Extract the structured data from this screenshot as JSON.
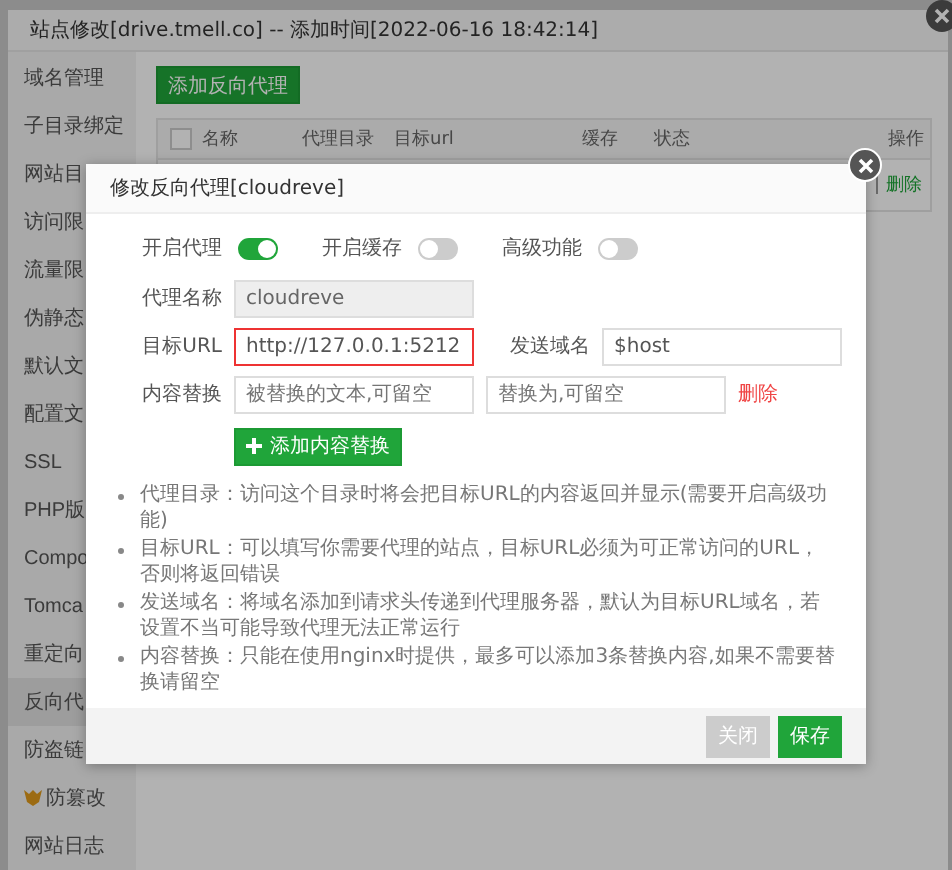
{
  "window": {
    "title": "站点修改[drive.tmell.co] -- 添加时间[2022-06-16 18:42:14]"
  },
  "sidebar": {
    "items": [
      {
        "label": "域名管理",
        "selected": false,
        "premium": false
      },
      {
        "label": "子目录绑定",
        "selected": false,
        "premium": false
      },
      {
        "label": "网站目",
        "selected": false,
        "premium": false
      },
      {
        "label": "访问限",
        "selected": false,
        "premium": false
      },
      {
        "label": "流量限",
        "selected": false,
        "premium": false
      },
      {
        "label": "伪静态",
        "selected": false,
        "premium": false
      },
      {
        "label": "默认文",
        "selected": false,
        "premium": false
      },
      {
        "label": "配置文",
        "selected": false,
        "premium": false
      },
      {
        "label": "SSL",
        "selected": false,
        "premium": false
      },
      {
        "label": "PHP版",
        "selected": false,
        "premium": false
      },
      {
        "label": "Compo",
        "selected": false,
        "premium": false
      },
      {
        "label": "Tomca",
        "selected": false,
        "premium": false
      },
      {
        "label": "重定向",
        "selected": false,
        "premium": false
      },
      {
        "label": "反向代",
        "selected": true,
        "premium": false
      },
      {
        "label": "防盗链",
        "selected": false,
        "premium": false
      },
      {
        "label": "防篡改",
        "selected": false,
        "premium": true
      },
      {
        "label": "网站日志",
        "selected": false,
        "premium": false
      }
    ]
  },
  "main": {
    "add_button": "添加反向代理",
    "table": {
      "select_all_checked": false,
      "columns": [
        "名称",
        "代理目录",
        "目标url",
        "缓存",
        "状态",
        "操作"
      ],
      "rows": [
        {
          "actions": "删除"
        }
      ]
    }
  },
  "dialog": {
    "title": "修改反向代理[cloudreve]",
    "switches": [
      {
        "label": "开启代理",
        "on": true
      },
      {
        "label": "开启缓存",
        "on": false
      },
      {
        "label": "高级功能",
        "on": false
      }
    ],
    "name_field": {
      "label": "代理名称",
      "value": "cloudreve",
      "disabled": true
    },
    "url_field": {
      "label": "目标URL",
      "value": "http://127.0.0.1:5212",
      "highlighted": true
    },
    "host_field": {
      "label": "发送域名",
      "value": "$host"
    },
    "replace": {
      "label": "内容替换",
      "from_placeholder": "被替换的文本,可留空",
      "to_placeholder": "替换为,可留空",
      "delete": "删除",
      "add_button": "添加内容替换"
    },
    "notes": [
      "代理目录：访问这个目录时将会把目标URL的内容返回并显示(需要开启高级功能)",
      "目标URL：可以填写你需要代理的站点，目标URL必须为可正常访问的URL，否则将返回错误",
      "发送域名：将域名添加到请求头传递到代理服务器，默认为目标URL域名，若设置不当可能导致代理无法正常运行",
      "内容替换：只能在使用nginx时提供，最多可以添加3条替换内容,如果不需要替换请留空"
    ],
    "buttons": [
      {
        "label": "关闭",
        "kind": "secondary"
      },
      {
        "label": "保存",
        "kind": "primary"
      }
    ]
  }
}
